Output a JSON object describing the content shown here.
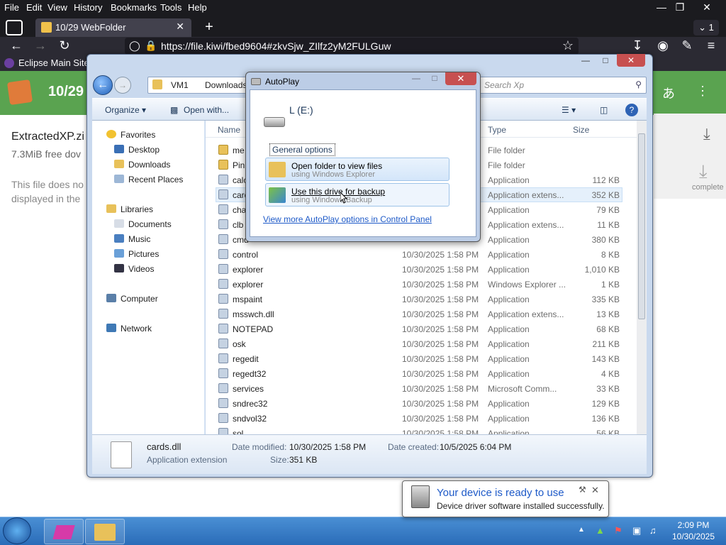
{
  "browser": {
    "menu": [
      "File",
      "Edit",
      "View",
      "History",
      "Bookmarks",
      "Tools",
      "Help"
    ],
    "tab_title": "10/29 WebFolder",
    "tab_count": "1",
    "url": "https://file.kiwi/fbed9604#zkvSjw_ZIlfz2yM2FULGuw",
    "bookmark": "Eclipse Main Site"
  },
  "webpage": {
    "header_title": "10/29",
    "file_name": "ExtractedXP.zi",
    "file_size": "7.3MiB  free dov",
    "note_line1": "This file does no",
    "note_line2": "displayed in the",
    "complete_label": "complete"
  },
  "explorer": {
    "breadcrumb": [
      "VM1",
      "Downloads"
    ],
    "search_placeholder": "Search Xp",
    "toolbar": {
      "organize": "Organize",
      "open_with": "Open with..."
    },
    "nav": {
      "favorites": "Favorites",
      "favorites_items": [
        "Desktop",
        "Downloads",
        "Recent Places"
      ],
      "libraries": "Libraries",
      "libraries_items": [
        "Documents",
        "Music",
        "Pictures",
        "Videos"
      ],
      "computer": "Computer",
      "network": "Network"
    },
    "columns": {
      "name": "Name",
      "type": "Type",
      "size": "Size"
    },
    "files": [
      {
        "name": "me",
        "date": "",
        "type": "File folder",
        "size": ""
      },
      {
        "name": "Pin",
        "date": "",
        "type": "File folder",
        "size": ""
      },
      {
        "name": "calc",
        "date": "",
        "type": "Application",
        "size": "112 KB"
      },
      {
        "name": "card",
        "date": "",
        "type": "Application extens...",
        "size": "352 KB"
      },
      {
        "name": "cha",
        "date": "",
        "type": "Application",
        "size": "79 KB"
      },
      {
        "name": "clb",
        "date": "",
        "type": "Application extens...",
        "size": "11 KB"
      },
      {
        "name": "cmd",
        "date": "",
        "type": "Application",
        "size": "380 KB"
      },
      {
        "name": "control",
        "date": "10/30/2025 1:58 PM",
        "type": "Application",
        "size": "8 KB"
      },
      {
        "name": "explorer",
        "date": "10/30/2025 1:58 PM",
        "type": "Application",
        "size": "1,010 KB"
      },
      {
        "name": "explorer",
        "date": "10/30/2025 1:58 PM",
        "type": "Windows Explorer ...",
        "size": "1 KB"
      },
      {
        "name": "mspaint",
        "date": "10/30/2025 1:58 PM",
        "type": "Application",
        "size": "335 KB"
      },
      {
        "name": "msswch.dll",
        "date": "10/30/2025 1:58 PM",
        "type": "Application extens...",
        "size": "13 KB"
      },
      {
        "name": "NOTEPAD",
        "date": "10/30/2025 1:58 PM",
        "type": "Application",
        "size": "68 KB"
      },
      {
        "name": "osk",
        "date": "10/30/2025 1:58 PM",
        "type": "Application",
        "size": "211 KB"
      },
      {
        "name": "regedit",
        "date": "10/30/2025 1:58 PM",
        "type": "Application",
        "size": "143 KB"
      },
      {
        "name": "regedt32",
        "date": "10/30/2025 1:58 PM",
        "type": "Application",
        "size": "4 KB"
      },
      {
        "name": "services",
        "date": "10/30/2025 1:58 PM",
        "type": "Microsoft Comm...",
        "size": "33 KB"
      },
      {
        "name": "sndrec32",
        "date": "10/30/2025 1:58 PM",
        "type": "Application",
        "size": "129 KB"
      },
      {
        "name": "sndvol32",
        "date": "10/30/2025 1:58 PM",
        "type": "Application",
        "size": "136 KB"
      },
      {
        "name": "sol",
        "date": "10/30/2025 1:58 PM",
        "type": "Application",
        "size": "56 KB"
      }
    ],
    "details": {
      "name": "cards.dll",
      "kind": "Application extension",
      "modified_label": "Date modified:",
      "modified_value": "10/30/2025 1:58 PM",
      "created_label": "Date created:",
      "created_value": "10/5/2025 6:04 PM",
      "size_label": "Size:",
      "size_value": "351 KB"
    }
  },
  "autoplay": {
    "title": "AutoPlay",
    "drive": "L (E:)",
    "section": "General options",
    "option1_title": "Open folder to view files",
    "option1_sub": "using Windows Explorer",
    "option2_title": "Use this drive for backup",
    "option2_sub": "using Windows Backup",
    "link": "View more AutoPlay options in Control Panel"
  },
  "notification": {
    "title": "Your device is ready to use",
    "message": "Device driver software installed successfully."
  },
  "taskbar": {
    "time": "2:09 PM",
    "date": "10/30/2025"
  }
}
